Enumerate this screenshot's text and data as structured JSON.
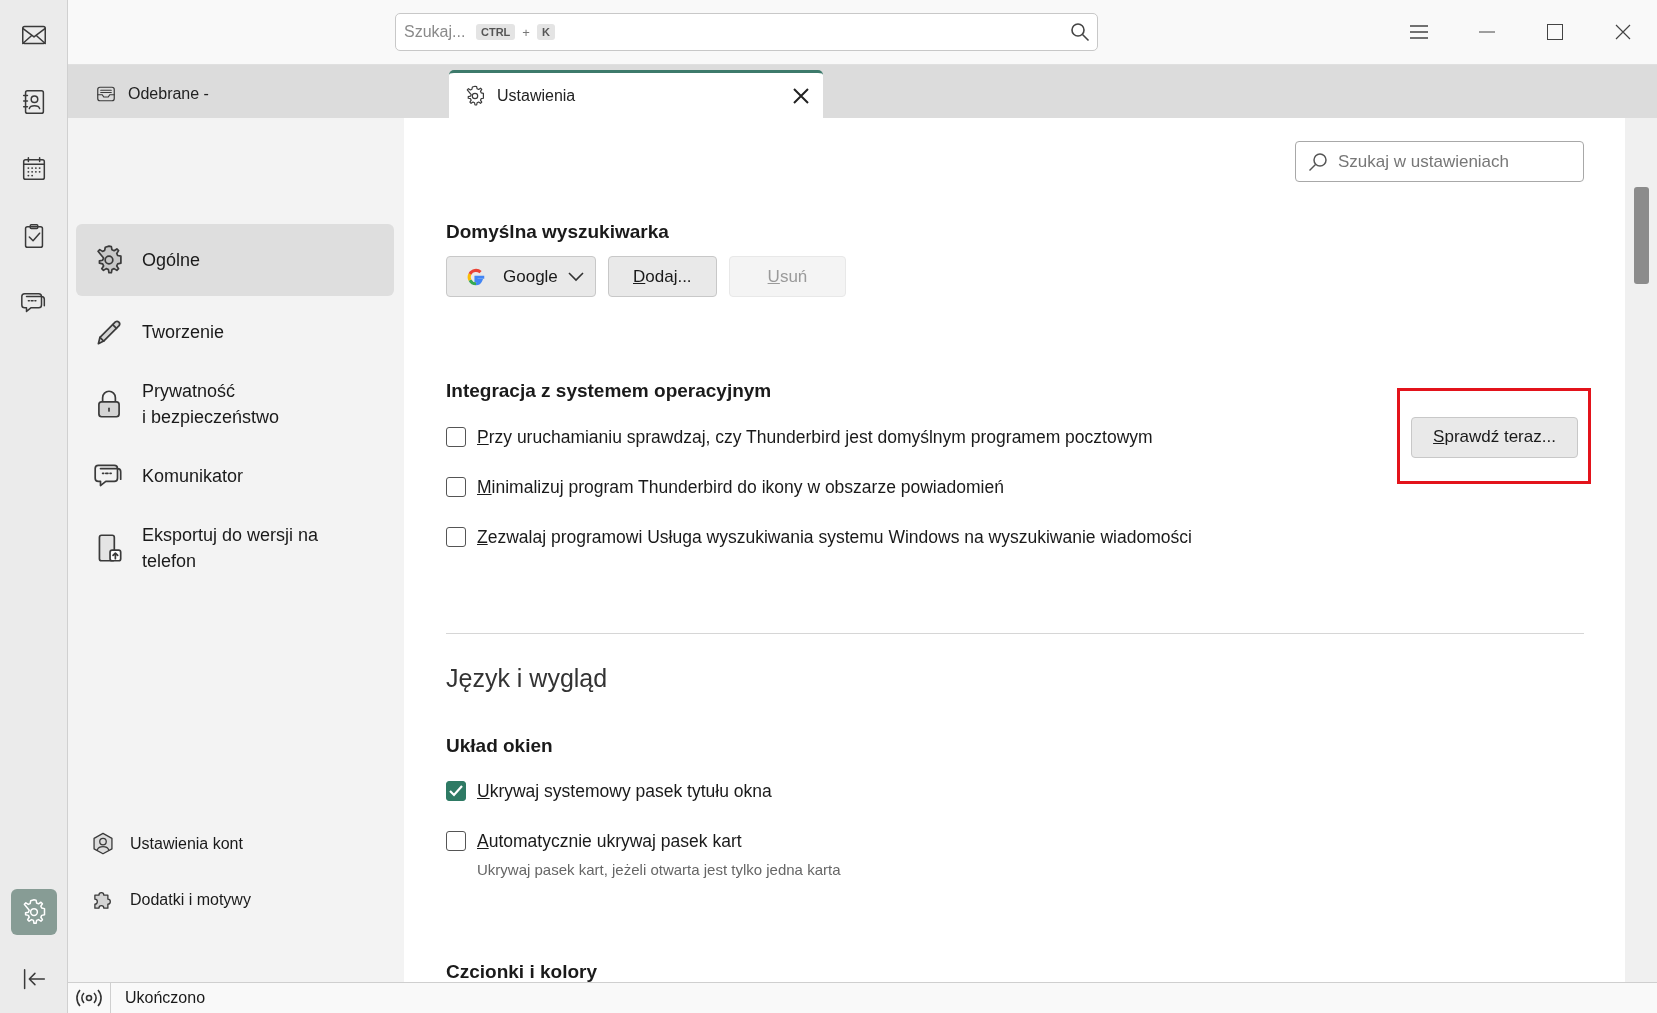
{
  "spaces": [
    {
      "kind": "mail",
      "selected": false
    },
    {
      "kind": "contacts",
      "selected": false
    },
    {
      "kind": "calendar",
      "selected": false
    },
    {
      "kind": "tasks",
      "selected": false
    },
    {
      "kind": "chat",
      "selected": false
    }
  ],
  "spaces_footer": [
    {
      "kind": "settings",
      "selected": true
    },
    {
      "kind": "collapse",
      "selected": false
    }
  ],
  "search": {
    "placeholder": "Szukaj...",
    "shortcut_keys": [
      "CTRL",
      "K"
    ],
    "shortcut_joiner": "+"
  },
  "tabs": [
    {
      "label": "Odebrane -",
      "kind": "inbox",
      "selected": false,
      "closable": false
    },
    {
      "label": "Ustawienia",
      "kind": "settings",
      "selected": true,
      "closable": true
    }
  ],
  "settings_search": {
    "placeholder": "Szukaj w ustawieniach"
  },
  "nav": {
    "items": [
      {
        "label": "Ogólne",
        "kind": "general",
        "selected": true
      },
      {
        "label": "Tworzenie",
        "kind": "compose",
        "selected": false
      },
      {
        "label": "Prywatność\ni bezpieczeństwo",
        "kind": "privacy",
        "selected": false
      },
      {
        "label": "Komunikator",
        "kind": "chat",
        "selected": false
      },
      {
        "label": "Eksportuj do wersji na telefon",
        "kind": "export",
        "selected": false
      }
    ],
    "footer_items": [
      {
        "label": "Ustawienia kont",
        "kind": "accounts"
      },
      {
        "label": "Dodatki i motywy",
        "kind": "addons"
      }
    ]
  },
  "blocks": [
    {
      "kind": "subheading",
      "text": "Domyślna wyszukiwarka"
    },
    {
      "kind": "engine-row",
      "engine": "Google",
      "buttons": [
        {
          "label": "Dodaj...",
          "disabled": false
        },
        {
          "label": "Usuń",
          "disabled": true
        }
      ]
    },
    {
      "kind": "subheading",
      "text": "Integracja z systemem operacyjnym"
    },
    {
      "kind": "checkbox",
      "label": "Przy uruchamianiu sprawdzaj, czy Thunderbird jest domyślnym programem pocztowym",
      "checked": false,
      "action": {
        "label": "Sprawdź teraz...",
        "highlighted": true
      }
    },
    {
      "kind": "checkbox",
      "label": "Minimalizuj program Thunderbird do ikony w obszarze powiadomień",
      "checked": false
    },
    {
      "kind": "checkbox",
      "label": "Zezwalaj programowi Usługa wyszukiwania systemu Windows na wyszukiwanie wiadomości",
      "checked": false
    },
    {
      "kind": "section",
      "text": "Język i wygląd"
    },
    {
      "kind": "subheading",
      "text": "Układ okien"
    },
    {
      "kind": "checkbox",
      "label": "Ukrywaj systemowy pasek tytułu okna",
      "checked": true
    },
    {
      "kind": "checkbox",
      "label": "Automatycznie ukrywaj pasek kart",
      "checked": false,
      "hint": "Ukrywaj pasek kart, jeżeli otwarta jest tylko jedna karta"
    },
    {
      "kind": "subheading",
      "text": "Czcionki i kolory"
    }
  ],
  "status_bar": {
    "text": "Ukończono"
  }
}
